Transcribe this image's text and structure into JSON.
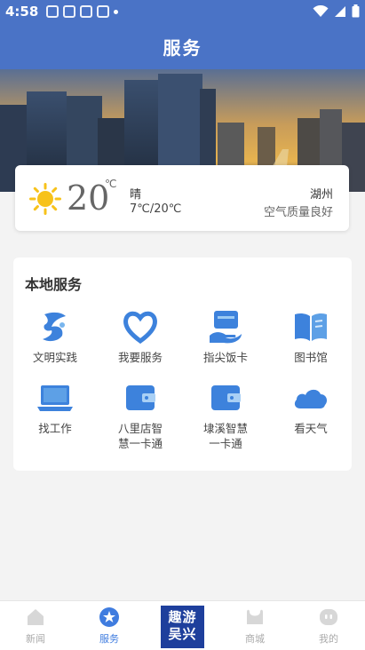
{
  "status_bar": {
    "time": "4:58",
    "notification_icons": [
      "app-icon",
      "app-icon",
      "app-icon",
      "app-icon"
    ],
    "system_icons": [
      "wifi-icon",
      "signal-icon",
      "battery-icon"
    ]
  },
  "header": {
    "title": "服务"
  },
  "weather": {
    "temperature": "20",
    "unit": "℃",
    "condition": "晴",
    "range": "7℃/20℃",
    "city": "湖州",
    "air_quality": "空气质量良好",
    "icon": "sun-icon"
  },
  "services": {
    "title": "本地服务",
    "items": [
      {
        "label": "文明实践",
        "icon": "civic-icon"
      },
      {
        "label": "我要服务",
        "icon": "heart-icon"
      },
      {
        "label": "指尖饭卡",
        "icon": "meal-card-icon"
      },
      {
        "label": "图书馆",
        "icon": "book-icon"
      },
      {
        "label": "找工作",
        "icon": "laptop-icon"
      },
      {
        "label": "八里店智\n慧一卡通",
        "icon": "wallet-icon"
      },
      {
        "label": "埭溪智慧\n一卡通",
        "icon": "wallet-icon"
      },
      {
        "label": "看天气",
        "icon": "cloud-icon"
      }
    ]
  },
  "bottom_nav": {
    "items": [
      {
        "label": "新闻",
        "icon": "news-icon"
      },
      {
        "label": "服务",
        "icon": "service-icon",
        "active": true
      },
      {
        "label": "商城",
        "icon": "shop-icon"
      },
      {
        "label": "我的",
        "icon": "profile-icon"
      }
    ],
    "center_logo": {
      "line1": "趣游",
      "line2": "吴兴"
    }
  },
  "colors": {
    "header": "#4a73c6",
    "accent": "#3f7cdf",
    "icon_blue": "#3d82dc"
  }
}
